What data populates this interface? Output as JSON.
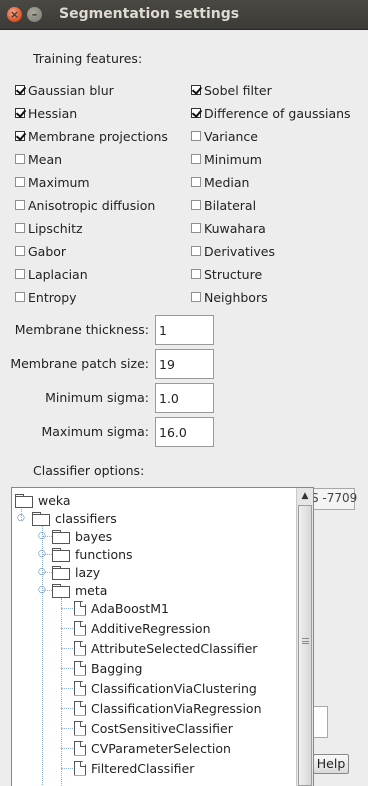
{
  "window": {
    "title": "Segmentation settings"
  },
  "training": {
    "label": "Training features:",
    "left": [
      {
        "label": "Gaussian blur",
        "checked": true
      },
      {
        "label": "Hessian",
        "checked": true
      },
      {
        "label": "Membrane projections",
        "checked": true
      },
      {
        "label": "Mean",
        "checked": false
      },
      {
        "label": "Maximum",
        "checked": false
      },
      {
        "label": "Anisotropic diffusion",
        "checked": false
      },
      {
        "label": "Lipschitz",
        "checked": false
      },
      {
        "label": "Gabor",
        "checked": false
      },
      {
        "label": "Laplacian",
        "checked": false
      },
      {
        "label": "Entropy",
        "checked": false
      }
    ],
    "right": [
      {
        "label": "Sobel filter",
        "checked": true
      },
      {
        "label": "Difference of gaussians",
        "checked": true
      },
      {
        "label": "Variance",
        "checked": false
      },
      {
        "label": "Minimum",
        "checked": false
      },
      {
        "label": "Median",
        "checked": false
      },
      {
        "label": "Bilateral",
        "checked": false
      },
      {
        "label": "Kuwahara",
        "checked": false
      },
      {
        "label": "Derivatives",
        "checked": false
      },
      {
        "label": "Structure",
        "checked": false
      },
      {
        "label": "Neighbors",
        "checked": false
      }
    ]
  },
  "params": [
    {
      "label": "Membrane thickness:",
      "value": "1"
    },
    {
      "label": "Membrane patch size:",
      "value": "19"
    },
    {
      "label": "Minimum sigma:",
      "value": "1.0"
    },
    {
      "label": "Maximum sigma:",
      "value": "16.0"
    }
  ],
  "classifier": {
    "label": "Classifier options:",
    "behind_text": "S -7709",
    "help_label": "Help",
    "tree": {
      "root": "weka",
      "classifiers": "classifiers",
      "packages": [
        "bayes",
        "functions",
        "lazy",
        "meta"
      ],
      "meta_items": [
        "AdaBoostM1",
        "AdditiveRegression",
        "AttributeSelectedClassifier",
        "Bagging",
        "ClassificationViaClustering",
        "ClassificationViaRegression",
        "CostSensitiveClassifier",
        "CVParameterSelection",
        "FilteredClassifier"
      ]
    }
  },
  "icons": {
    "close": "close-icon",
    "minimize": "minimize-icon",
    "folder": "folder-icon",
    "file": "file-icon"
  }
}
